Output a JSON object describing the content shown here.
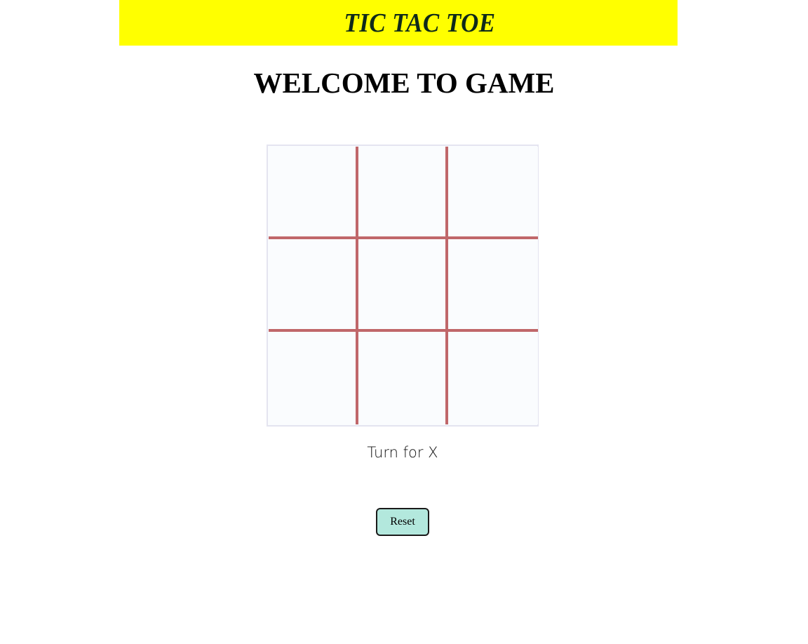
{
  "header": {
    "title": "TIC TAC TOE"
  },
  "main": {
    "welcome": "WELCOME TO GAME",
    "board": {
      "cells": [
        "",
        "",
        "",
        "",
        "",
        "",
        "",
        "",
        ""
      ]
    },
    "turn_text": "Turn for X",
    "reset_label": "Reset"
  },
  "colors": {
    "banner": "#ffff00",
    "grid_lines": "#c0676a",
    "reset_button": "#b3e8dd"
  }
}
